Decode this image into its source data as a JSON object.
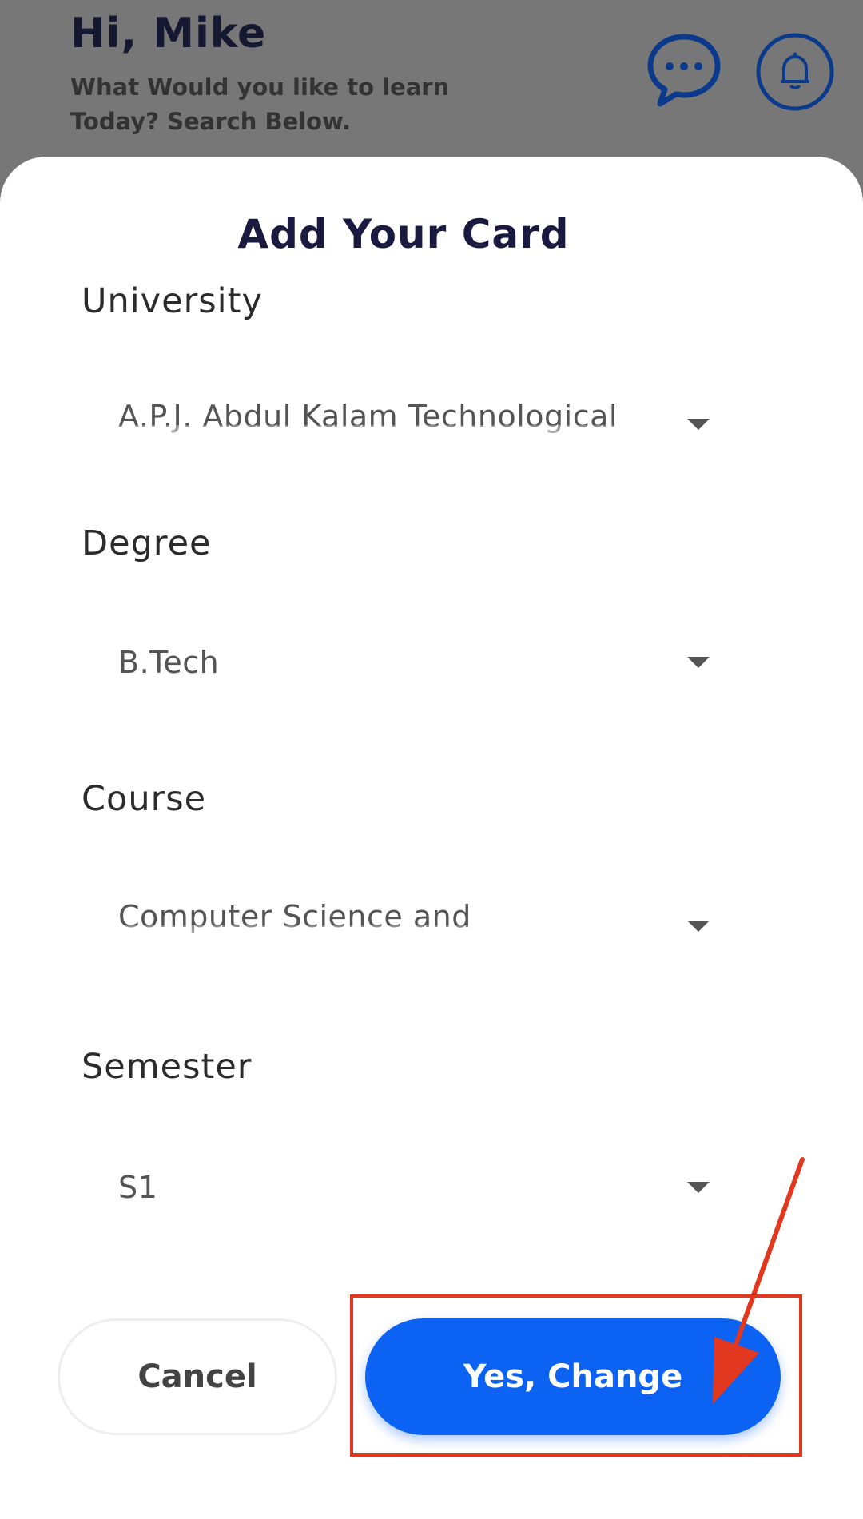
{
  "header": {
    "greeting": "Hi, Mike",
    "subtitle": "What Would you like to learn Today? Search Below.",
    "chat_icon": "chat-bubble-icon",
    "bell_icon": "bell-icon"
  },
  "sheet": {
    "title": "Add Your Card",
    "fields": [
      {
        "label": "University",
        "value": "A.P.J. Abdul Kalam Technological University"
      },
      {
        "label": "Degree",
        "value": "B.Tech"
      },
      {
        "label": "Course",
        "value": "Computer Science and Engineering"
      },
      {
        "label": "Semester",
        "value": "S1"
      }
    ],
    "cancel_label": "Cancel",
    "confirm_label": "Yes, Change"
  },
  "colors": {
    "primary": "#0c62f2",
    "annotation": "#e1381f",
    "header_bg": "#777777",
    "title": "#1a1a40"
  }
}
